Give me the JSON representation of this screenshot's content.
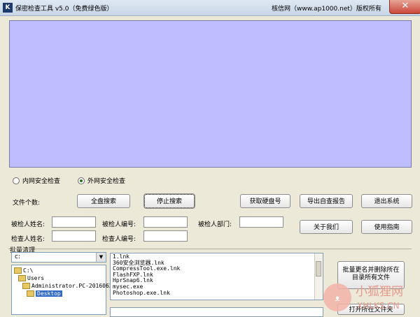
{
  "window": {
    "title": "保密检查工具 v5.0（免费绿色版）",
    "title_right": "核信网（www.ap1000.net）版权所有",
    "close_glyph": "✕",
    "app_icon_text": "K"
  },
  "mode": {
    "options": [
      "内网安全检查",
      "外网安全检查"
    ],
    "selected": "外网安全检查"
  },
  "labels": {
    "file_count": "文件个数:",
    "inspected_name": "被检人姓名:",
    "inspected_id": "被检人编号:",
    "inspected_dept": "被检人部门:",
    "inspector_name": "检查人姓名:",
    "inspector_id": "检查人编号:",
    "batch_clean": "批量清理"
  },
  "buttons": {
    "full_scan": "全盘搜索",
    "stop_scan": "停止搜索",
    "get_disk_no": "获取硬盘号",
    "export_report": "导出自查报告",
    "exit": "退出系统",
    "about": "关于我们",
    "guide": "使用指南",
    "batch_rename_delete_line1": "批量更名并删除所在",
    "batch_rename_delete_line2": "目录所有文件",
    "open_folder": "打开所在文件夹"
  },
  "drive": {
    "value": "c:"
  },
  "tree": {
    "items": [
      "C:\\",
      "Users",
      "Administrator.PC-20160621",
      "Desktop"
    ],
    "selected": "Desktop"
  },
  "files": [
    "1.lnk",
    "360安全浏览器.lnk",
    "CompressTool.exe.lnk",
    "FlashFXP.lnk",
    "HprSnap6.lnk",
    "mysec.exe",
    "Photoshop.exe.lnk"
  ],
  "watermark": {
    "cn": "小狐狸网",
    "en": "XHLKS.CN"
  },
  "colors": {
    "canvas": "#bdbdff",
    "selection": "#316ac5"
  }
}
